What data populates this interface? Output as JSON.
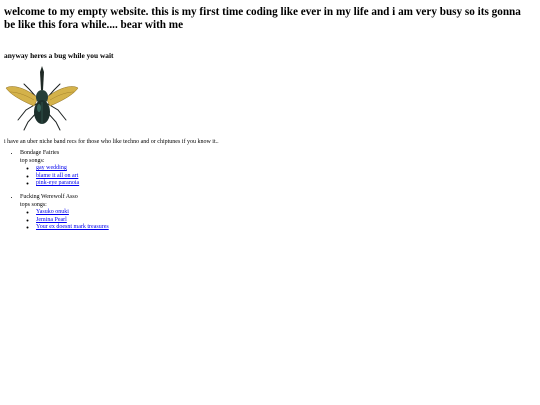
{
  "heading": "welcome to my empty website. this is my first time coding like ever in my life and i am very busy so its gonna be like this fora while.... bear with me",
  "subheading": "anyway heres a bug while you wait",
  "bug_image": {
    "icon": "rhinoceros-beetle-icon"
  },
  "intro": "i have an uber niche band recs for those who like techno and or chiptunes if you know it..",
  "bands": [
    {
      "name": "Bondage Fairies",
      "songs_label": "top songs:",
      "songs": [
        "gay wedding",
        "blame it all on art",
        "pink-eye paranoia"
      ]
    },
    {
      "name": "Fucking Werewolf Asso",
      "songs_label": "tops songs:",
      "songs": [
        "Yasuko onuki",
        "Jemina Pearl",
        "Your ex doesnt mark treasures"
      ]
    }
  ]
}
